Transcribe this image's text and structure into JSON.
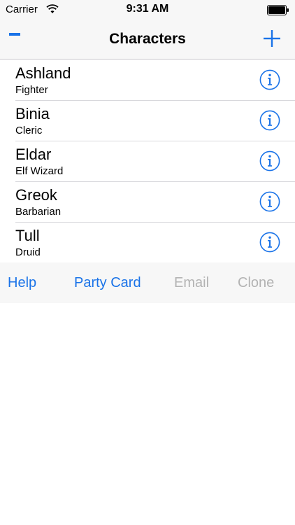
{
  "status_bar": {
    "carrier": "Carrier",
    "time": "9:31 AM"
  },
  "nav": {
    "title": "Characters"
  },
  "characters": [
    {
      "name": "Ashland",
      "class": "Fighter"
    },
    {
      "name": "Binia",
      "class": "Cleric"
    },
    {
      "name": "Eldar",
      "class": "Elf Wizard"
    },
    {
      "name": "Greok",
      "class": "Barbarian"
    },
    {
      "name": "Tull",
      "class": "Druid"
    }
  ],
  "toolbar": {
    "help": "Help",
    "party_card": "Party Card",
    "email": "Email",
    "clone": "Clone"
  },
  "colors": {
    "accent": "#1a73e8",
    "disabled": "#b3b3b3"
  },
  "icons": {
    "delete": "minus-icon",
    "add": "plus-icon",
    "detail": "info-icon",
    "wifi": "wifi-icon",
    "battery": "battery-icon"
  }
}
